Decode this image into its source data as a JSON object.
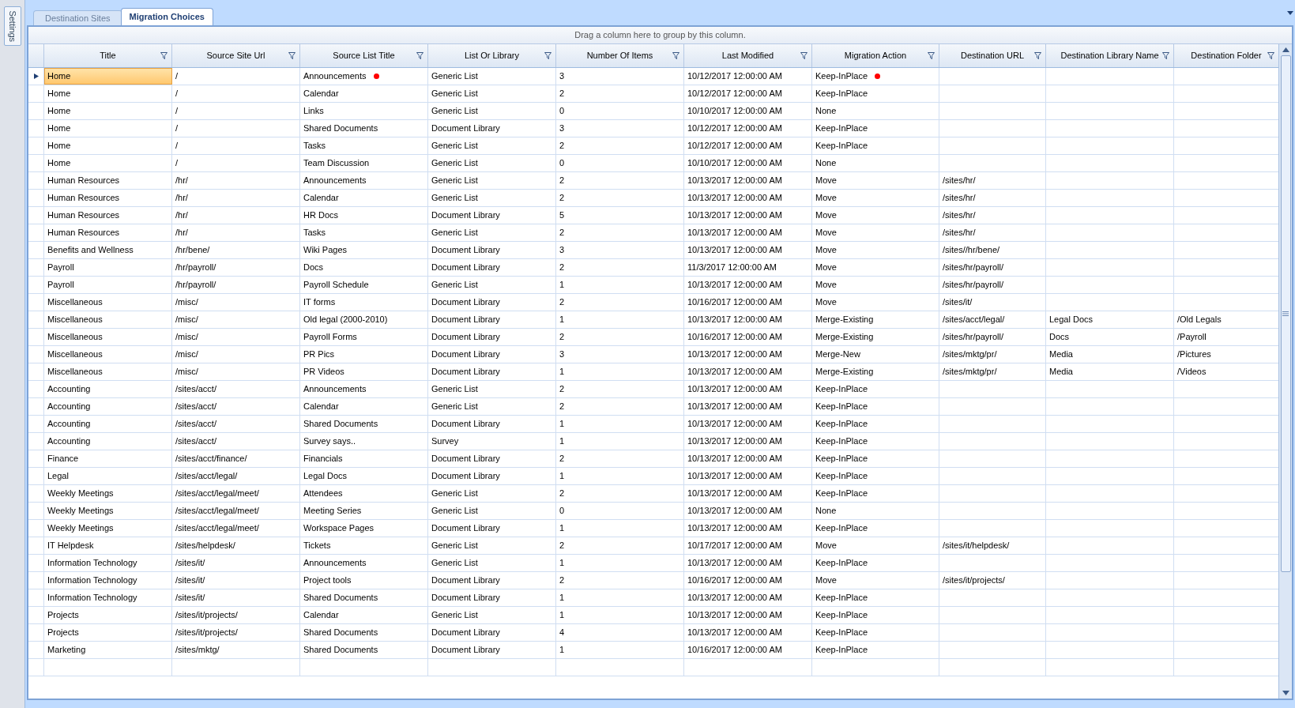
{
  "side_tab": {
    "label": "Settings"
  },
  "tabs": [
    {
      "label": "Destination Sites",
      "selected": false
    },
    {
      "label": "Migration Choices",
      "selected": true
    }
  ],
  "group_panel": {
    "hint": "Drag a column here to group by this column."
  },
  "grid": {
    "columns": [
      "Title",
      "Source Site Url",
      "Source List Title",
      "List Or Library",
      "Number Of Items",
      "Last Modified",
      "Migration Action",
      "Destination URL",
      "Destination Library Name",
      "Destination Folder"
    ],
    "rows": [
      {
        "selected": true,
        "list_flagged": true,
        "action_flagged": true,
        "cells": [
          "Home",
          "/",
          "Announcements",
          "Generic List",
          "3",
          "10/12/2017 12:00:00 AM",
          "Keep-InPlace",
          "",
          "",
          ""
        ]
      },
      {
        "selected": false,
        "list_flagged": false,
        "action_flagged": false,
        "cells": [
          "Home",
          "/",
          "Calendar",
          "Generic List",
          "2",
          "10/12/2017 12:00:00 AM",
          "Keep-InPlace",
          "",
          "",
          ""
        ]
      },
      {
        "selected": false,
        "list_flagged": false,
        "action_flagged": false,
        "cells": [
          "Home",
          "/",
          "Links",
          "Generic List",
          "0",
          "10/10/2017 12:00:00 AM",
          "None",
          "",
          "",
          ""
        ]
      },
      {
        "selected": false,
        "list_flagged": false,
        "action_flagged": false,
        "cells": [
          "Home",
          "/",
          "Shared Documents",
          "Document Library",
          "3",
          "10/12/2017 12:00:00 AM",
          "Keep-InPlace",
          "",
          "",
          ""
        ]
      },
      {
        "selected": false,
        "list_flagged": false,
        "action_flagged": false,
        "cells": [
          "Home",
          "/",
          "Tasks",
          "Generic List",
          "2",
          "10/12/2017 12:00:00 AM",
          "Keep-InPlace",
          "",
          "",
          ""
        ]
      },
      {
        "selected": false,
        "list_flagged": false,
        "action_flagged": false,
        "cells": [
          "Home",
          "/",
          "Team Discussion",
          "Generic List",
          "0",
          "10/10/2017 12:00:00 AM",
          "None",
          "",
          "",
          ""
        ]
      },
      {
        "selected": false,
        "list_flagged": false,
        "action_flagged": false,
        "cells": [
          "Human Resources",
          "/hr/",
          "Announcements",
          "Generic List",
          "2",
          "10/13/2017 12:00:00 AM",
          "Move",
          "/sites/hr/",
          "",
          ""
        ]
      },
      {
        "selected": false,
        "list_flagged": false,
        "action_flagged": false,
        "cells": [
          "Human Resources",
          "/hr/",
          "Calendar",
          "Generic List",
          "2",
          "10/13/2017 12:00:00 AM",
          "Move",
          "/sites/hr/",
          "",
          ""
        ]
      },
      {
        "selected": false,
        "list_flagged": false,
        "action_flagged": false,
        "cells": [
          "Human Resources",
          "/hr/",
          "HR Docs",
          "Document Library",
          "5",
          "10/13/2017 12:00:00 AM",
          "Move",
          "/sites/hr/",
          "",
          ""
        ]
      },
      {
        "selected": false,
        "list_flagged": false,
        "action_flagged": false,
        "cells": [
          "Human Resources",
          "/hr/",
          "Tasks",
          "Generic List",
          "2",
          "10/13/2017 12:00:00 AM",
          "Move",
          "/sites/hr/",
          "",
          ""
        ]
      },
      {
        "selected": false,
        "list_flagged": false,
        "action_flagged": false,
        "cells": [
          "Benefits and Wellness",
          "/hr/bene/",
          "Wiki Pages",
          "Document Library",
          "3",
          "10/13/2017 12:00:00 AM",
          "Move",
          "/sites//hr/bene/",
          "",
          ""
        ]
      },
      {
        "selected": false,
        "list_flagged": false,
        "action_flagged": false,
        "cells": [
          "Payroll",
          "/hr/payroll/",
          "Docs",
          "Document Library",
          "2",
          "11/3/2017 12:00:00 AM",
          "Move",
          "/sites/hr/payroll/",
          "",
          ""
        ]
      },
      {
        "selected": false,
        "list_flagged": false,
        "action_flagged": false,
        "cells": [
          "Payroll",
          "/hr/payroll/",
          "Payroll Schedule",
          "Generic List",
          "1",
          "10/13/2017 12:00:00 AM",
          "Move",
          "/sites/hr/payroll/",
          "",
          ""
        ]
      },
      {
        "selected": false,
        "list_flagged": false,
        "action_flagged": false,
        "cells": [
          "Miscellaneous",
          "/misc/",
          "IT forms",
          "Document Library",
          "2",
          "10/16/2017 12:00:00 AM",
          "Move",
          "/sites/it/",
          "",
          ""
        ]
      },
      {
        "selected": false,
        "list_flagged": false,
        "action_flagged": false,
        "cells": [
          "Miscellaneous",
          "/misc/",
          "Old legal (2000-2010)",
          "Document Library",
          "1",
          "10/13/2017 12:00:00 AM",
          "Merge-Existing",
          "/sites/acct/legal/",
          "Legal Docs",
          "/Old Legals"
        ]
      },
      {
        "selected": false,
        "list_flagged": false,
        "action_flagged": false,
        "cells": [
          "Miscellaneous",
          "/misc/",
          "Payroll Forms",
          "Document Library",
          "2",
          "10/16/2017 12:00:00 AM",
          "Merge-Existing",
          "/sites/hr/payroll/",
          "Docs",
          "/Payroll"
        ]
      },
      {
        "selected": false,
        "list_flagged": false,
        "action_flagged": false,
        "cells": [
          "Miscellaneous",
          "/misc/",
          "PR Pics",
          "Document Library",
          "3",
          "10/13/2017 12:00:00 AM",
          "Merge-New",
          "/sites/mktg/pr/",
          "Media",
          "/Pictures"
        ]
      },
      {
        "selected": false,
        "list_flagged": false,
        "action_flagged": false,
        "cells": [
          "Miscellaneous",
          "/misc/",
          "PR Videos",
          "Document Library",
          "1",
          "10/13/2017 12:00:00 AM",
          "Merge-Existing",
          "/sites/mktg/pr/",
          "Media",
          "/Videos"
        ]
      },
      {
        "selected": false,
        "list_flagged": false,
        "action_flagged": false,
        "cells": [
          "Accounting",
          "/sites/acct/",
          "Announcements",
          "Generic List",
          "2",
          "10/13/2017 12:00:00 AM",
          "Keep-InPlace",
          "",
          "",
          ""
        ]
      },
      {
        "selected": false,
        "list_flagged": false,
        "action_flagged": false,
        "cells": [
          "Accounting",
          "/sites/acct/",
          "Calendar",
          "Generic List",
          "2",
          "10/13/2017 12:00:00 AM",
          "Keep-InPlace",
          "",
          "",
          ""
        ]
      },
      {
        "selected": false,
        "list_flagged": false,
        "action_flagged": false,
        "cells": [
          "Accounting",
          "/sites/acct/",
          "Shared Documents",
          "Document Library",
          "1",
          "10/13/2017 12:00:00 AM",
          "Keep-InPlace",
          "",
          "",
          ""
        ]
      },
      {
        "selected": false,
        "list_flagged": false,
        "action_flagged": false,
        "cells": [
          "Accounting",
          "/sites/acct/",
          "Survey says..",
          "Survey",
          "1",
          "10/13/2017 12:00:00 AM",
          "Keep-InPlace",
          "",
          "",
          ""
        ]
      },
      {
        "selected": false,
        "list_flagged": false,
        "action_flagged": false,
        "cells": [
          "Finance",
          "/sites/acct/finance/",
          "Financials",
          "Document Library",
          "2",
          "10/13/2017 12:00:00 AM",
          "Keep-InPlace",
          "",
          "",
          ""
        ]
      },
      {
        "selected": false,
        "list_flagged": false,
        "action_flagged": false,
        "cells": [
          "Legal",
          "/sites/acct/legal/",
          "Legal Docs",
          "Document Library",
          "1",
          "10/13/2017 12:00:00 AM",
          "Keep-InPlace",
          "",
          "",
          ""
        ]
      },
      {
        "selected": false,
        "list_flagged": false,
        "action_flagged": false,
        "cells": [
          "Weekly Meetings",
          "/sites/acct/legal/meet/",
          "Attendees",
          "Generic List",
          "2",
          "10/13/2017 12:00:00 AM",
          "Keep-InPlace",
          "",
          "",
          ""
        ]
      },
      {
        "selected": false,
        "list_flagged": false,
        "action_flagged": false,
        "cells": [
          "Weekly Meetings",
          "/sites/acct/legal/meet/",
          "Meeting Series",
          "Generic List",
          "0",
          "10/13/2017 12:00:00 AM",
          "None",
          "",
          "",
          ""
        ]
      },
      {
        "selected": false,
        "list_flagged": false,
        "action_flagged": false,
        "cells": [
          "Weekly Meetings",
          "/sites/acct/legal/meet/",
          "Workspace Pages",
          "Document Library",
          "1",
          "10/13/2017 12:00:00 AM",
          "Keep-InPlace",
          "",
          "",
          ""
        ]
      },
      {
        "selected": false,
        "list_flagged": false,
        "action_flagged": false,
        "cells": [
          "IT Helpdesk",
          "/sites/helpdesk/",
          "Tickets",
          "Generic List",
          "2",
          "10/17/2017 12:00:00 AM",
          "Move",
          "/sites/it/helpdesk/",
          "",
          ""
        ]
      },
      {
        "selected": false,
        "list_flagged": false,
        "action_flagged": false,
        "cells": [
          "Information Technology",
          "/sites/it/",
          "Announcements",
          "Generic List",
          "1",
          "10/13/2017 12:00:00 AM",
          "Keep-InPlace",
          "",
          "",
          ""
        ]
      },
      {
        "selected": false,
        "list_flagged": false,
        "action_flagged": false,
        "cells": [
          "Information Technology",
          "/sites/it/",
          "Project tools",
          "Document Library",
          "2",
          "10/16/2017 12:00:00 AM",
          "Move",
          "/sites/it/projects/",
          "",
          ""
        ]
      },
      {
        "selected": false,
        "list_flagged": false,
        "action_flagged": false,
        "cells": [
          "Information Technology",
          "/sites/it/",
          "Shared Documents",
          "Document Library",
          "1",
          "10/13/2017 12:00:00 AM",
          "Keep-InPlace",
          "",
          "",
          ""
        ]
      },
      {
        "selected": false,
        "list_flagged": false,
        "action_flagged": false,
        "cells": [
          "Projects",
          "/sites/it/projects/",
          "Calendar",
          "Generic List",
          "1",
          "10/13/2017 12:00:00 AM",
          "Keep-InPlace",
          "",
          "",
          ""
        ]
      },
      {
        "selected": false,
        "list_flagged": false,
        "action_flagged": false,
        "cells": [
          "Projects",
          "/sites/it/projects/",
          "Shared Documents",
          "Document Library",
          "4",
          "10/13/2017 12:00:00 AM",
          "Keep-InPlace",
          "",
          "",
          ""
        ]
      },
      {
        "selected": false,
        "list_flagged": false,
        "action_flagged": false,
        "cells": [
          "Marketing",
          "/sites/mktg/",
          "Shared Documents",
          "Document Library",
          "1",
          "10/16/2017 12:00:00 AM",
          "Keep-InPlace",
          "",
          "",
          ""
        ]
      }
    ]
  }
}
